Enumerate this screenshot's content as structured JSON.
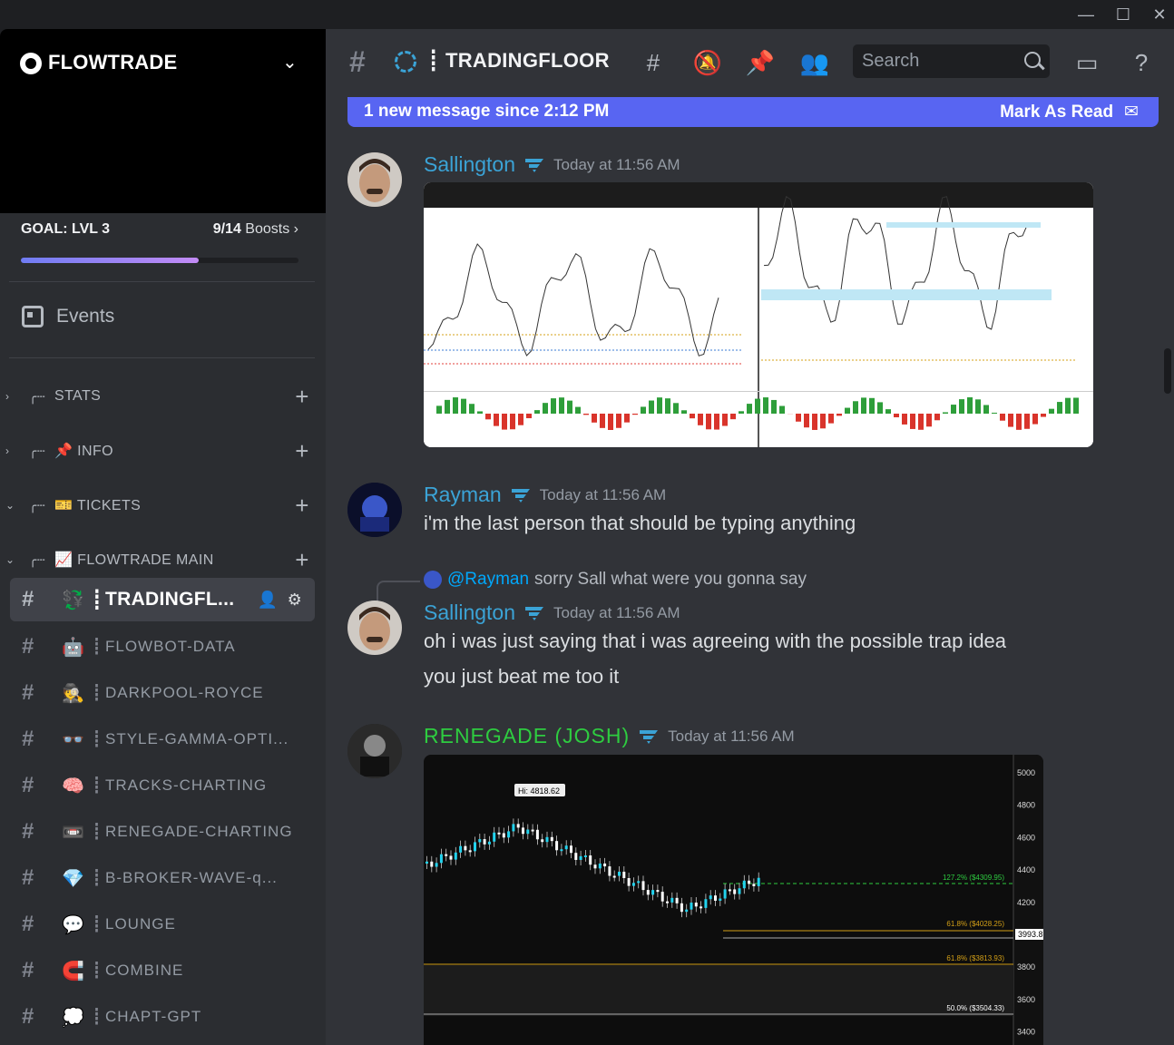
{
  "window": {
    "min": "—",
    "max": "☐",
    "close": "✕"
  },
  "server": {
    "name": "FLOWTRADE",
    "goal": "GOAL: LVL 3",
    "boosts_count": "9/14",
    "boosts_label": "Boosts",
    "boost_progress": 0.64
  },
  "sidebar": {
    "events_label": "Events",
    "categories": [
      {
        "label": "STATS",
        "emoji": ""
      },
      {
        "label": "INFO",
        "emoji": "📌"
      },
      {
        "label": "TICKETS",
        "emoji": "🎫"
      },
      {
        "label": "FLOWTRADE MAIN",
        "emoji": "📈"
      }
    ],
    "channels": [
      {
        "name": "TRADINGFL...",
        "emoji": "💱",
        "active": true
      },
      {
        "name": "FLOWBOT-DATA",
        "emoji": "🤖"
      },
      {
        "name": "DARKPOOL-ROYCE",
        "emoji": "🕵"
      },
      {
        "name": "STYLE-GAMMA-OPTI...",
        "emoji": "👓"
      },
      {
        "name": "TRACKS-CHARTING",
        "emoji": "🧠"
      },
      {
        "name": "RENEGADE-CHARTING",
        "emoji": "📼"
      },
      {
        "name": "B-BROKER-WAVE-q...",
        "emoji": "💎"
      },
      {
        "name": "LOUNGE",
        "emoji": "💬"
      },
      {
        "name": "COMBINE",
        "emoji": "🧲"
      },
      {
        "name": "CHAPT-GPT",
        "emoji": "💭"
      }
    ]
  },
  "header": {
    "channel_title": "TRADINGFLOOR",
    "search_placeholder": "Search"
  },
  "banner": {
    "text": "1 new message since 2:12 PM",
    "action": "Mark As Read"
  },
  "messages": [
    {
      "author": "Sallington",
      "color": "#3ba3d6",
      "time": "Today at 11:56 AM"
    },
    {
      "author": "Rayman",
      "color": "#3ba3d6",
      "time": "Today at 11:56 AM",
      "text": "i'm the last person that should be typing anything"
    },
    {
      "reply_to": "@Rayman",
      "reply_text": "sorry Sall what were you gonna say",
      "author": "Sallington",
      "color": "#3ba3d6",
      "time": "Today at 11:56 AM",
      "lines": [
        "oh i was just saying that i was agreeing with the possible trap idea",
        "you just beat me too it"
      ]
    },
    {
      "author": "RENEGADE (JOSH)",
      "color": "#2ecc40",
      "time": "Today at 11:56 AM"
    }
  ],
  "chart2": {
    "hi_label": "Hi: 4818.62",
    "y_ticks": [
      "5000",
      "4800",
      "4600",
      "4400",
      "4200",
      "4000",
      "3800",
      "3600",
      "3400"
    ],
    "fib_labels": [
      "127.2% ($4309.95)",
      "61.8% ($4028.25)",
      "61.8% ($3813.93)",
      "50.0% ($3504.33)"
    ],
    "price_tag": "3993.8"
  }
}
